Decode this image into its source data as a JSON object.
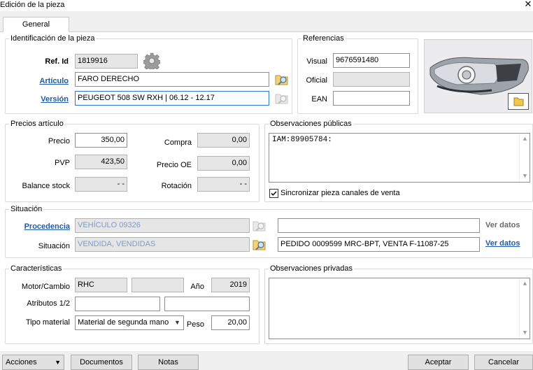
{
  "window": {
    "title": "Edición de la pieza",
    "close_glyph": "✕"
  },
  "tabs": [
    {
      "label": "General",
      "active": true
    }
  ],
  "identificacion": {
    "legend": "Identificación de la pieza",
    "ref_id_label": "Ref. Id",
    "ref_id_value": "1819916",
    "articulo_label": "Artículo",
    "articulo_value": "FARO DERECHO",
    "version_label": "Versión",
    "version_value": "PEUGEOT 508 SW RXH   |   06.12 - 12.17"
  },
  "referencias": {
    "legend": "Referencias",
    "visual_label": "Visual",
    "visual_value": "9676591480",
    "oficial_label": "Oficial",
    "oficial_value": "",
    "ean_label": "EAN",
    "ean_value": ""
  },
  "precios": {
    "legend": "Precios artículo",
    "precio_label": "Precio",
    "precio_value": "350,00",
    "pvp_label": "PVP",
    "pvp_value": "423,50",
    "balance_label": "Balance stock",
    "balance_value": "- -",
    "compra_label": "Compra",
    "compra_value": "0,00",
    "precio_oe_label": "Precio OE",
    "precio_oe_value": "0,00",
    "rotacion_label": "Rotación",
    "rotacion_value": "- -"
  },
  "obs_publicas": {
    "legend": "Observaciones públicas",
    "text": "IAM:89905784:",
    "sync_label": "Sincronizar pieza canales de venta",
    "sync_checked": true
  },
  "situacion": {
    "legend": "Situación",
    "procedencia_label": "Procedencia",
    "procedencia_value": "VEHÍCULO 09326",
    "procedencia_extra": "",
    "procedencia_ver": "Ver datos",
    "situacion_label": "Situación",
    "situacion_value": "VENDIDA, VENDIDAS",
    "situacion_extra": "PEDIDO 0009599 MRC-BPT,  VENTA F-11087-25",
    "situacion_ver": "Ver datos"
  },
  "caracteristicas": {
    "legend": "Características",
    "motor_label": "Motor/Cambio",
    "motor_value": "RHC",
    "cambio_value": "",
    "anio_label": "Año",
    "anio_value": "2019",
    "atributos_label": "Atributos 1/2",
    "atributo1_value": "",
    "atributo2_value": "",
    "tipo_label": "Tipo material",
    "tipo_value": "Material de segunda mano",
    "peso_label": "Peso",
    "peso_value": "20,00"
  },
  "obs_privadas": {
    "legend": "Observaciones privadas",
    "text": ""
  },
  "footer": {
    "acciones": "Acciones",
    "documentos": "Documentos",
    "notas": "Notas",
    "aceptar": "Aceptar",
    "cancelar": "Cancelar"
  },
  "icons": {
    "gear": "gear-icon",
    "lookup": "folder-magnifier-icon",
    "photo_folder": "folder-icon"
  }
}
